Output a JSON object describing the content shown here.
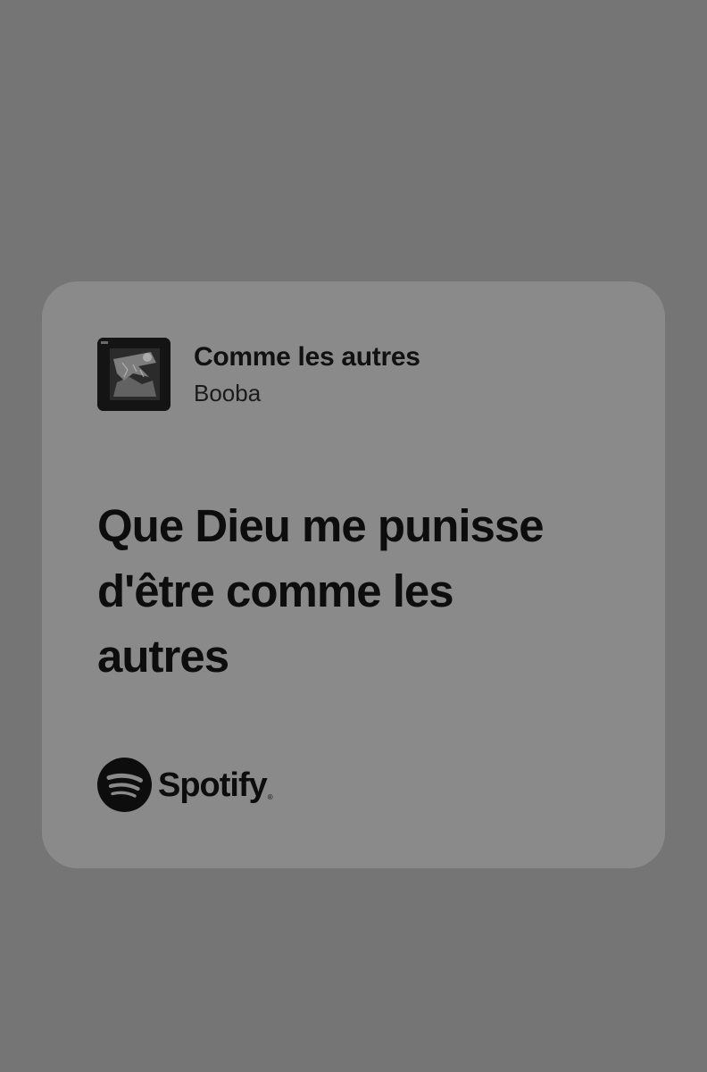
{
  "track": {
    "title": "Comme les autres",
    "artist": "Booba",
    "album_art_icon": "album-cover"
  },
  "lyrics": {
    "lines": [
      "Que Dieu me punisse",
      "d'être comme les",
      "autres"
    ]
  },
  "brand": {
    "name": "Spotify",
    "trademark": "®",
    "icon": "spotify-logo-icon"
  },
  "colors": {
    "background": "#757575",
    "card": "#8a8a8a",
    "text": "#0d0d0d"
  }
}
